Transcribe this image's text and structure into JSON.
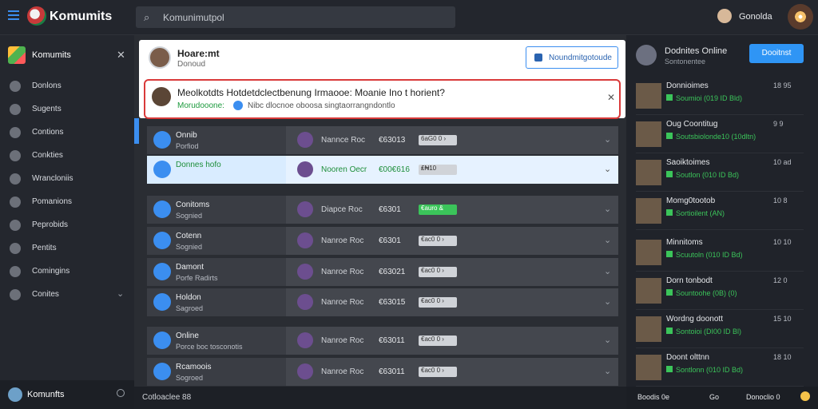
{
  "top": {
    "title": "Komumits",
    "search_placeholder": "Komunimutpol",
    "user": "Gonolda"
  },
  "sidebar": {
    "title": "Komumits",
    "items": [
      {
        "label": "Donlons"
      },
      {
        "label": "Sugents"
      },
      {
        "label": "Contions"
      },
      {
        "label": "Conkties"
      },
      {
        "label": "Wrancloniis"
      },
      {
        "label": "Pomanions"
      },
      {
        "label": "Peprobids"
      },
      {
        "label": "Pentits"
      },
      {
        "label": "Comingins"
      },
      {
        "label": "Conites"
      }
    ],
    "footer_user": "Komunfts"
  },
  "main": {
    "card": {
      "title": "Hoare:mt",
      "sub": "Donoud",
      "button": "Noundmitgotoude"
    },
    "alert": {
      "title": "Meolkotdts Hotdetdclectbenung Irmaooe: Moanie Ino t horient?",
      "sub1": "Morudooone:",
      "sub2": "Nibc dlocnoe oboosa singtaorrangndontlo"
    },
    "rows": [
      {
        "l1": "Onnib",
        "l2": "Porfiod",
        "rt": "Nannce Roc",
        "num": "€63013",
        "tag": "6aG0 0 ›"
      },
      {
        "l1": "Donnes hofo",
        "l2": "",
        "rt": "Nooren Oecr",
        "num": "€00€616",
        "tag": "₤₦10",
        "sel": true
      },
      {
        "l1": "Conitoms",
        "l2": "Sognied",
        "rt": "Diapce Roc",
        "num": "€6301",
        "tag": "€auro &",
        "green": true
      },
      {
        "l1": "Cotenn",
        "l2": "Sognied",
        "rt": "Nanroe Roc",
        "num": "€6301",
        "tag": "€ac0 0 ›"
      },
      {
        "l1": "Damont",
        "l2": "Porfe Radirts",
        "rt": "Nanroe Roc",
        "num": "€63021",
        "tag": "€ac0 0 ›"
      },
      {
        "l1": "Holdon",
        "l2": "Sagroed",
        "rt": "Nanroe Roc",
        "num": "€63015",
        "tag": "€ac0 0 ›"
      },
      {
        "l1": "Online",
        "l2": "Porce boc tosconotis",
        "rt": "Nanroe Roc",
        "num": "€63011",
        "tag": "€ac0 0 ›"
      },
      {
        "l1": "Rcamoois",
        "l2": "Sogroed",
        "rt": "Nanroe Roc",
        "num": "€63011",
        "tag": "€ac0 0 ›"
      }
    ]
  },
  "status": {
    "text": "Cotloaclee 88"
  },
  "right": {
    "header": {
      "title": "Dodnites Online",
      "sub": "Sontonentee",
      "button": "Dooitnst"
    },
    "friends": [
      {
        "name": "Donnioimes",
        "sub": "Soumioi (019 ID Bld)",
        "meta": "18 95"
      },
      {
        "name": "Oug Coontitug",
        "sub": "Soutsbiolonde10 (10dltn)",
        "meta": "9 9"
      },
      {
        "name": "Saoiktoimes",
        "sub": "Soutlon (010 ID Bd)",
        "meta": "10 ad"
      },
      {
        "name": "Momg0tootob",
        "sub": "Sortioilent (AN)",
        "meta": "10 8"
      },
      {
        "name": "Minnitoms",
        "sub": "Scuutoln (010 ID Bd)",
        "meta": "10 10"
      },
      {
        "name": "Dorn tonbodt",
        "sub": "Sountoohe (0B) (0)",
        "meta": "12 0"
      },
      {
        "name": "Wordng doonott",
        "sub": "Sontoioi (DI00 ID Bl)",
        "meta": "15 10"
      },
      {
        "name": "Doont olttnn",
        "sub": "Sontlonn (010 ID Bd)",
        "meta": "18 10"
      }
    ],
    "footer": {
      "a": "Boodis 0e",
      "b": "Go",
      "c": "Donoclio 0"
    }
  },
  "colors": {
    "accent": "#3b8ef0",
    "alert": "#d93a3a",
    "success": "#1d8e3a"
  }
}
